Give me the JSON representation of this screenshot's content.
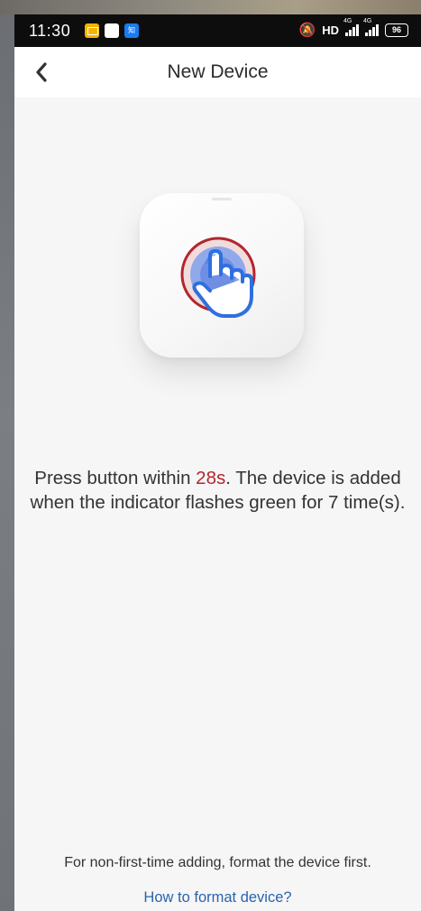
{
  "status_bar": {
    "time": "11:30",
    "hd_label": "HD",
    "signal1_label": "4G",
    "signal2_label": "4G",
    "battery": "96",
    "notif_blue_label": "知"
  },
  "header": {
    "title": "New Device"
  },
  "instruction": {
    "before": "Press button within ",
    "countdown": "28s",
    "after": ". The device is added when the indicator flashes green for 7 time(s)."
  },
  "footer": {
    "note": "For non-first-time adding, format the device first.",
    "link": "How to format device?"
  },
  "colors": {
    "countdown": "#b3262e",
    "link": "#2a63b0",
    "ring": "#b3262e",
    "hand": "#2f6fe0"
  }
}
